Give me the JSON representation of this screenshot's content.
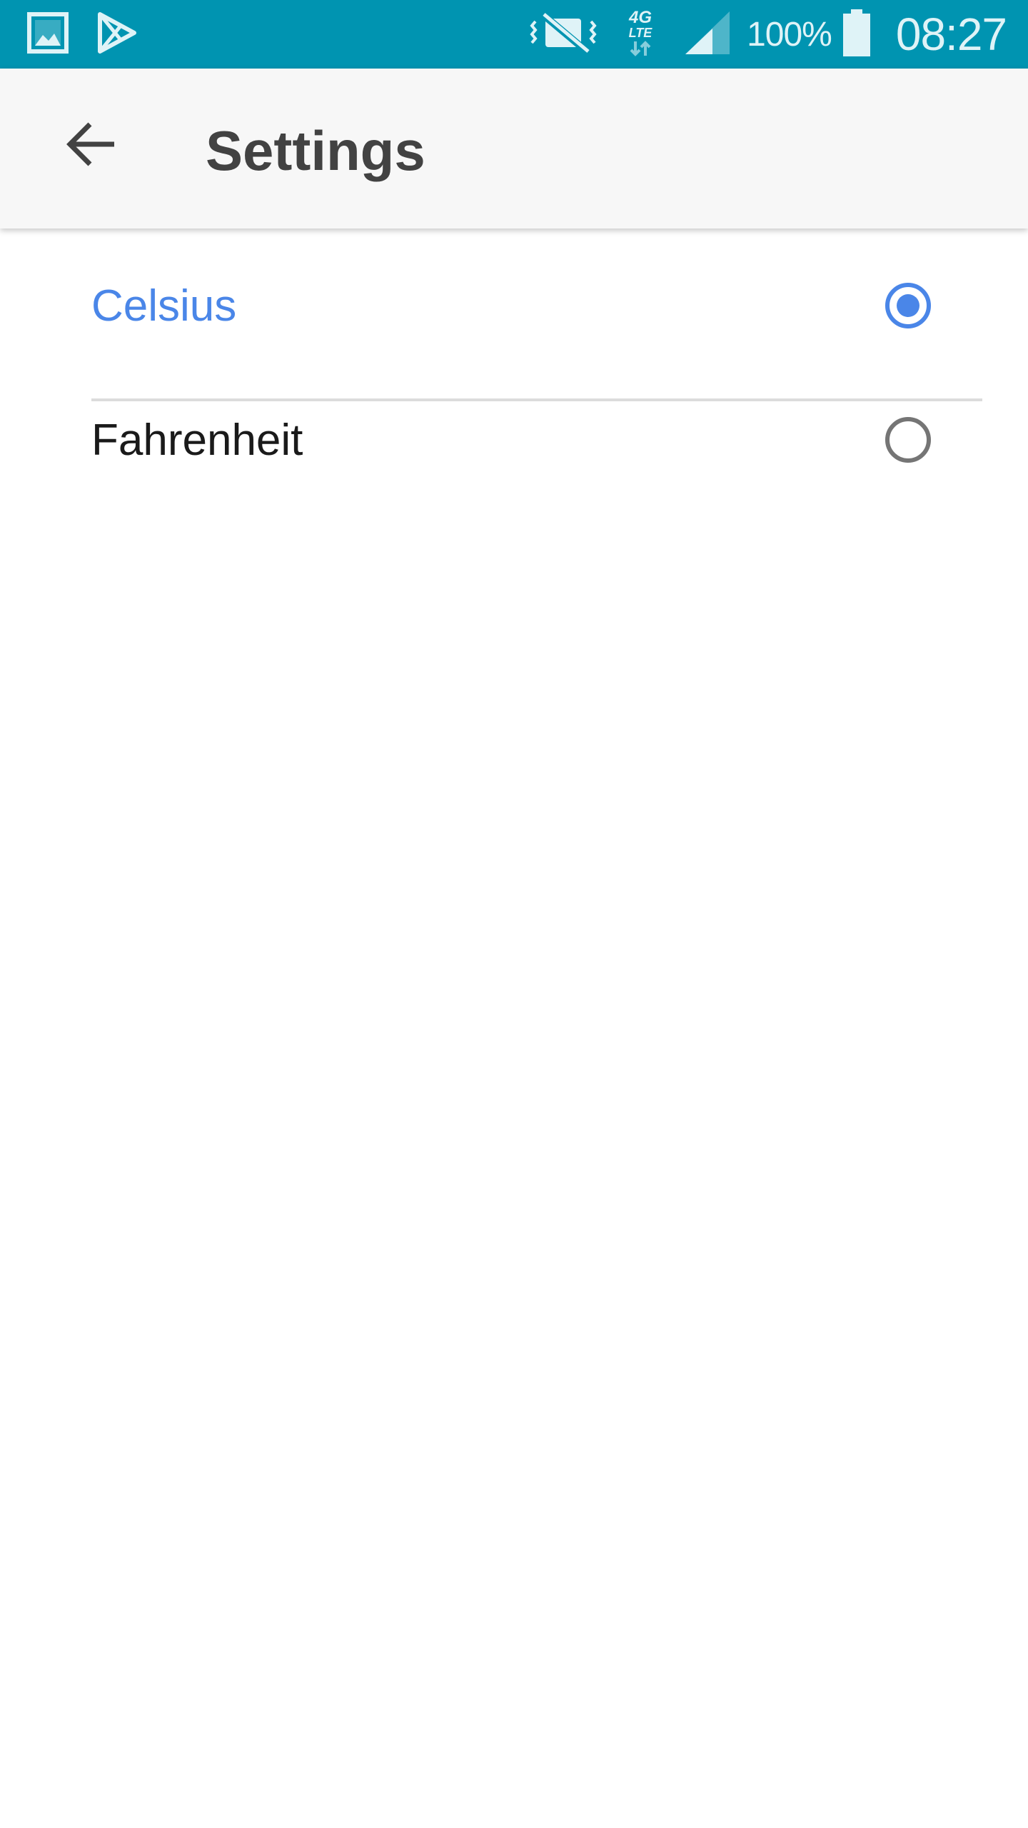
{
  "status_bar": {
    "left_icons": [
      "gallery-icon",
      "play-store-icon"
    ],
    "right_icons": [
      "vibrate-muted-icon",
      "4g-lte-icon",
      "signal-icon",
      "battery-icon"
    ],
    "network_label_top": "4G",
    "network_label_bottom": "LTE",
    "battery_percent": "100%",
    "time": "08:27",
    "background_color": "#0094b1"
  },
  "app_bar": {
    "back_icon": "arrow-back-icon",
    "title": "Settings"
  },
  "options": [
    {
      "label": "Celsius",
      "selected": true
    },
    {
      "label": "Fahrenheit",
      "selected": false
    }
  ],
  "colors": {
    "accent": "#4a86e8",
    "radio_unchecked": "#757575",
    "title_text": "#424242",
    "app_bar_bg": "#f7f7f7"
  }
}
